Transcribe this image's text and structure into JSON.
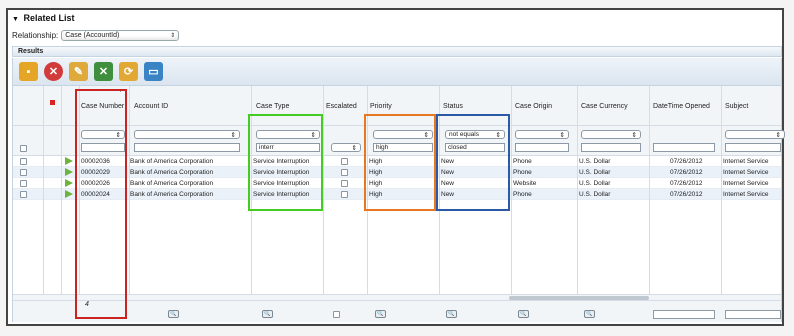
{
  "panel": {
    "title": "Related List",
    "relationship_label": "Relationship:",
    "relationship_value": "Case (AccountId)",
    "results_label": "Results"
  },
  "toolbar": {
    "buttons": [
      {
        "name": "save-icon",
        "color": "#e0a020"
      },
      {
        "name": "delete-icon",
        "color": "#cc3333"
      },
      {
        "name": "edit-icon",
        "color": "#d8a238"
      },
      {
        "name": "excel-icon",
        "color": "#3f8f3f"
      },
      {
        "name": "refresh-icon",
        "color": "#e0a020"
      },
      {
        "name": "window-icon",
        "color": "#3a83c5"
      }
    ]
  },
  "grid": {
    "sort_marker": "▼",
    "headers": {
      "case_number": "Case Number",
      "account_id": "Account ID",
      "case_type": "Case Type",
      "escalated": "Escalated",
      "priority": "Priority",
      "status": "Status",
      "case_origin": "Case Origin",
      "case_currency": "Case Currency",
      "datetime_opened": "DateTime Opened",
      "subject": "Subject"
    },
    "filters": {
      "case_type": "interr",
      "priority": "high",
      "status_operator": "not equals",
      "status": "closed"
    },
    "rows": [
      {
        "case_number": "00002036",
        "account_id": "Bank of America Corporation",
        "case_type": "Service Interruption",
        "priority": "High",
        "status": "New",
        "case_origin": "Phone",
        "case_currency": "U.S. Dollar",
        "datetime_opened": "07/26/2012",
        "subject": "Internet Service"
      },
      {
        "case_number": "00002029",
        "account_id": "Bank of America Corporation",
        "case_type": "Service Interruption",
        "priority": "High",
        "status": "New",
        "case_origin": "Phone",
        "case_currency": "U.S. Dollar",
        "datetime_opened": "07/26/2012",
        "subject": "Internet Service"
      },
      {
        "case_number": "00002026",
        "account_id": "Bank of America Corporation",
        "case_type": "Service Interruption",
        "priority": "High",
        "status": "New",
        "case_origin": "Website",
        "case_currency": "U.S. Dollar",
        "datetime_opened": "07/26/2012",
        "subject": "Internet Service"
      },
      {
        "case_number": "00002024",
        "account_id": "Bank of America Corporation",
        "case_type": "Service Interruption",
        "priority": "High",
        "status": "New",
        "case_origin": "Phone",
        "case_currency": "U.S. Dollar",
        "datetime_opened": "07/26/2012",
        "subject": "Internet Service"
      }
    ],
    "footer_count": "4",
    "search_glyph": "🔍"
  },
  "highlights": {
    "red": "#cc2222",
    "green": "#44cc22",
    "orange": "#e87722",
    "blue": "#2a5aa6"
  },
  "colors": {
    "row_alt": "#eaf1f9",
    "header_bg": "#f2f5f8",
    "row_arrow": "#6db33f",
    "marker": "#dd2222"
  }
}
